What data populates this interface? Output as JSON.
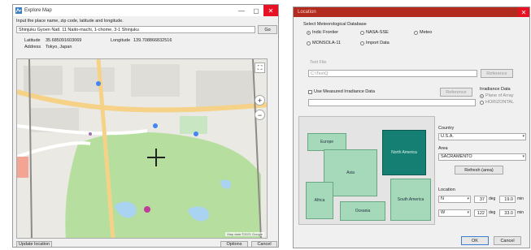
{
  "left_window": {
    "title": "Explore Map",
    "window_controls": {
      "minimize": "—",
      "maximize": "▢",
      "close": "✕"
    },
    "instruction": "Input the place name, zip code, latitude and longitude.",
    "search_value": "Shinjuku Gyoen Natl. 11 Naito-machi, 1-chome, 3-1 Shinjuku",
    "search_button": "Go",
    "coords": {
      "latitude_label": "Latitude",
      "latitude_value": "35.685091603069",
      "longitude_label": "Longitude",
      "longitude_value": "139.708866832516",
      "address_label": "Address",
      "address_value": "Tokyo, Japan"
    },
    "map_attribution": "Map data ©2021 Google",
    "update_button": "Update location",
    "options_button": "Options",
    "cancel_button": "Cancel"
  },
  "right_window": {
    "title": "Location",
    "db_group_label": "Select Meteorological Database",
    "databases": [
      {
        "label": "Indic Frontier",
        "selected": true
      },
      {
        "label": "NASA-SSE",
        "selected": false
      },
      {
        "label": "Meteo",
        "selected": false
      },
      {
        "label": "MONSOLA-11",
        "selected": false
      },
      {
        "label": "Import Data",
        "selected": false
      }
    ],
    "file_label": "Text File",
    "file_value": "C:\\Tex\\Q",
    "reference_label": "Reference",
    "measured_label": "Use Measured Irradiance Data",
    "measured_reference": "Reference",
    "irradiance_group": "Irradiance Data",
    "irradiance_options": [
      {
        "label": "Plane of Array",
        "selected": true
      },
      {
        "label": "HORIZONTAL",
        "selected": false
      }
    ],
    "regions": {
      "europe": "Europe",
      "north_america": "North America",
      "asia": "Asia",
      "africa": "Africa",
      "oceania": "Oceania",
      "south_america": "South America"
    },
    "country_label": "Country",
    "country_value": "U.S.A.",
    "area_label": "Area",
    "area_value": "SACRAMENTO",
    "refresh_button": "Refresh (area)",
    "location_label": "Location",
    "lat": {
      "dir": "N",
      "deg": "37",
      "deg_unit": "deg",
      "min": "19.0",
      "min_unit": "min"
    },
    "lon": {
      "dir": "W",
      "deg": "122",
      "deg_unit": "deg",
      "min": "33.0",
      "min_unit": "min"
    },
    "ok_button": "OK",
    "cancel_button": "Cancel"
  }
}
